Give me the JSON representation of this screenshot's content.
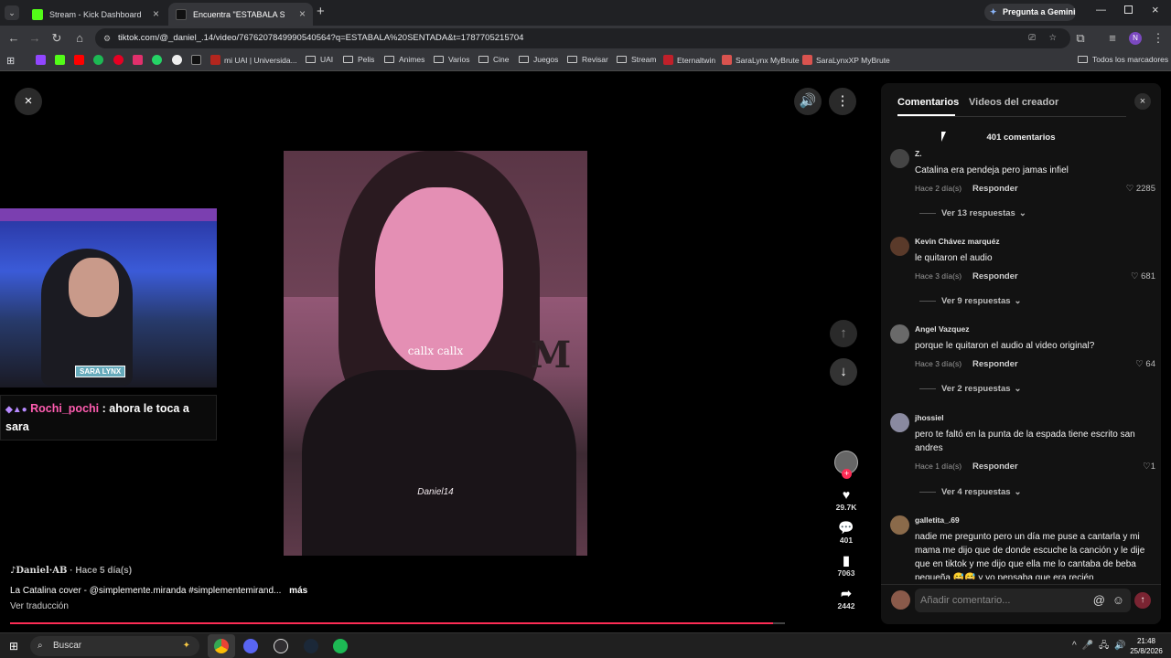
{
  "tabs": [
    {
      "title": "Stream - Kick Dashboard",
      "active": false
    },
    {
      "title": "Encuentra \"ESTABALA SENTADA\"",
      "active": true
    }
  ],
  "gemini_label": "Pregunta a Gemini",
  "url": "tiktok.com/@_daniel_.14/video/7676207849990540564?q=ESTABALA%20SENTADA&t=1787705215704",
  "profile_initial": "N",
  "bookmarks": [
    {
      "label": "mi UAI | Universida...",
      "type": "site"
    },
    {
      "label": "UAI",
      "type": "folder"
    },
    {
      "label": "Pelis",
      "type": "folder"
    },
    {
      "label": "Animes",
      "type": "folder"
    },
    {
      "label": "Varios",
      "type": "folder"
    },
    {
      "label": "Cine",
      "type": "folder"
    },
    {
      "label": "Juegos",
      "type": "folder"
    },
    {
      "label": "Revisar",
      "type": "folder"
    },
    {
      "label": "Stream",
      "type": "folder"
    },
    {
      "label": "Eternaltwin",
      "type": "site"
    },
    {
      "label": "SaraLynx MyBrute",
      "type": "site"
    },
    {
      "label": "SaraLynxXP MyBrute",
      "type": "site"
    }
  ],
  "all_bookmarks_label": "Todos los marcadores",
  "video": {
    "overlay_text_1": "callx callx",
    "overlay_text_2": "Daniel14",
    "bg_letter": "M"
  },
  "webcam": {
    "name_tag": "SARA LYNX"
  },
  "chat_overlay": {
    "user": "Rochi_pochi",
    "message": ": ahora le toca a sara"
  },
  "author_line": {
    "name": "♪Daniel·AB",
    "time": "· Hace 5 día(s)"
  },
  "caption": "La Catalina cover - @simplemente.miranda #simplementemirand...",
  "more_label": "más",
  "translate_label": "Ver traducción",
  "actions": {
    "likes": "29.7K",
    "comments": "401",
    "saves": "7063",
    "shares": "2442"
  },
  "panel": {
    "tab_comments": "Comentarios",
    "tab_creator": "Videos del creador",
    "count_label": "401 comentarios",
    "input_placeholder": "Añadir comentario...",
    "reply_label": "Responder",
    "comments": [
      {
        "user": "Z.",
        "text": "Catalina era pendeja pero jamas infiel",
        "time": "Hace 2 día(s)",
        "likes": "2285",
        "replies": "Ver 13 respuestas"
      },
      {
        "user": "Kevin Chávez marquéz",
        "text": "le quitaron el audio",
        "time": "Hace 3 día(s)",
        "likes": "681",
        "replies": "Ver 9 respuestas"
      },
      {
        "user": "Angel Vazquez",
        "text": "porque le quitaron el audio al video original?",
        "time": "Hace 3 día(s)",
        "likes": "64",
        "replies": "Ver 2 respuestas"
      },
      {
        "user": "jhossiel",
        "text": "pero te faltó en la punta de la espada tiene escrito san andres",
        "time": "Hace 1 día(s)",
        "likes": "1",
        "replies": "Ver 4 respuestas"
      },
      {
        "user": "galletita_.69",
        "text": "nadie me pregunto pero un día me puse a cantarla y mi mama me dijo que de donde escuche la canción y le dije que en tiktok y me dijo que ella me lo cantaba de beba pequeña 😅😅 y yo pensaba que era recién",
        "time": "",
        "likes": "",
        "replies": ""
      }
    ]
  },
  "taskbar": {
    "search_label": "Buscar",
    "time": "21:48",
    "date": "25/8/2026"
  },
  "colors": {
    "accent_red": "#fe2c55",
    "progress_red": "#fe2c55",
    "kick_green": "#53fc18"
  }
}
